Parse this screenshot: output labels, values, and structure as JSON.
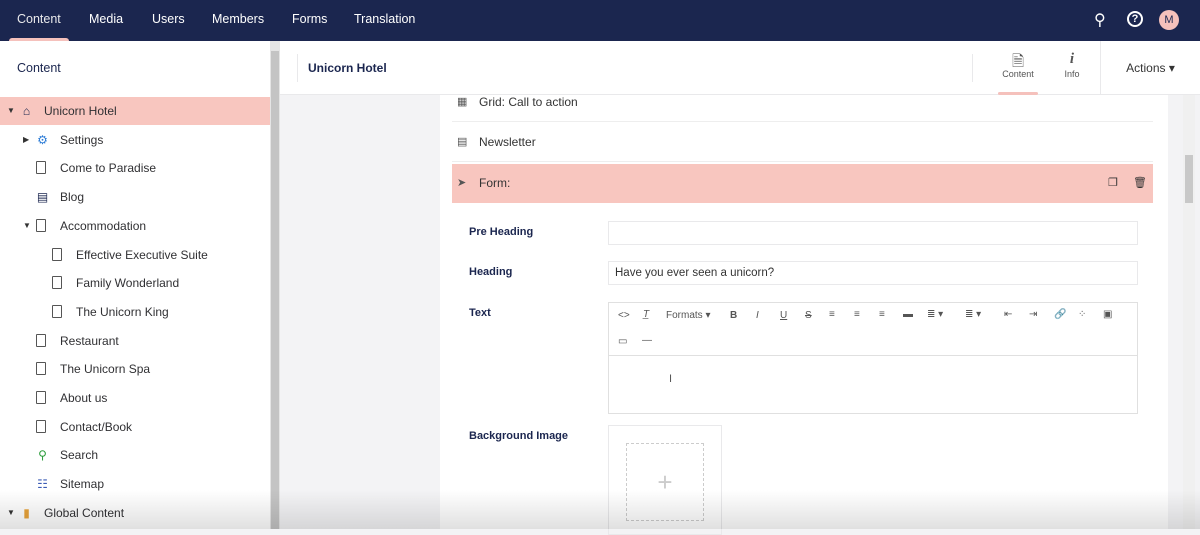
{
  "topnav": {
    "items": [
      "Content",
      "Media",
      "Users",
      "Members",
      "Forms",
      "Translation"
    ],
    "avatar": "M"
  },
  "sidebar": {
    "title": "Content",
    "items": [
      {
        "label": "Unicorn Hotel",
        "icon": "home-icon"
      },
      {
        "label": "Settings",
        "icon": "gear-icon"
      },
      {
        "label": "Come to Paradise",
        "icon": "document-icon"
      },
      {
        "label": "Blog",
        "icon": "blog-icon"
      },
      {
        "label": "Accommodation",
        "icon": "document-icon"
      },
      {
        "label": "Effective Executive Suite",
        "icon": "document-icon"
      },
      {
        "label": "Family Wonderland",
        "icon": "document-icon"
      },
      {
        "label": "The Unicorn King",
        "icon": "document-icon"
      },
      {
        "label": "Restaurant",
        "icon": "document-icon"
      },
      {
        "label": "The Unicorn Spa",
        "icon": "document-icon"
      },
      {
        "label": "About us",
        "icon": "document-icon"
      },
      {
        "label": "Contact/Book",
        "icon": "document-icon"
      },
      {
        "label": "Search",
        "icon": "search-icon"
      },
      {
        "label": "Sitemap",
        "icon": "sitemap-icon"
      },
      {
        "label": "Global Content",
        "icon": "folder-icon"
      }
    ]
  },
  "header": {
    "name": "Unicorn Hotel",
    "apps": [
      "Content",
      "Info"
    ],
    "actions": "Actions"
  },
  "blocks": [
    "Grid: Call to action",
    "Newsletter",
    "Form:"
  ],
  "form": {
    "pre_heading_label": "Pre Heading",
    "pre_heading_value": "",
    "heading_label": "Heading",
    "heading_value": "Have you ever seen a unicorn?",
    "text_label": "Text",
    "formats": "Formats",
    "bg_label": "Background Image"
  }
}
